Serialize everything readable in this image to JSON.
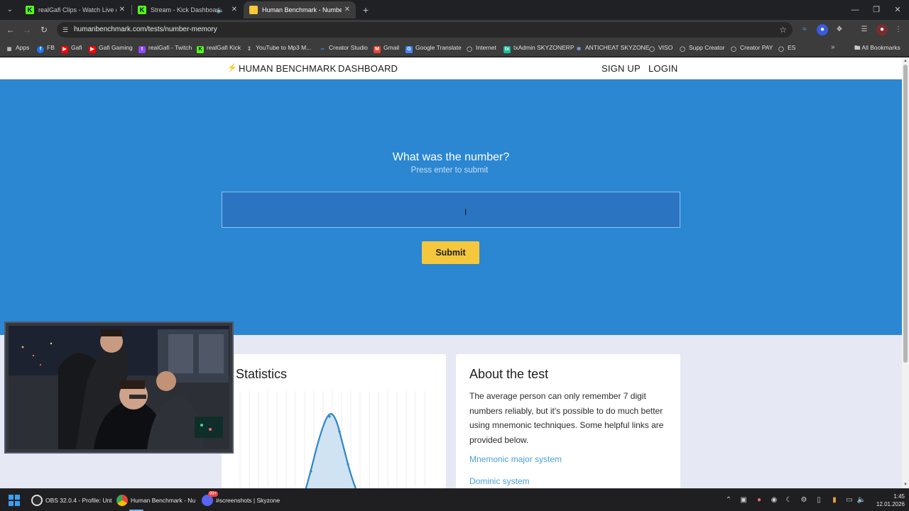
{
  "browser": {
    "tabs": [
      {
        "title": "realGafi Clips - Watch Live on K",
        "favicon": "kick-icon",
        "active": false
      },
      {
        "title": "Stream - Kick Dashboard",
        "favicon": "kick-icon",
        "active": false,
        "audio": true
      },
      {
        "title": "Human Benchmark - Number M",
        "favicon": "human-benchmark-icon",
        "active": true
      }
    ],
    "url": "humanbenchmark.com/tests/number-memory",
    "bookmarks": [
      {
        "label": "Apps",
        "icon": "apps-grid-icon"
      },
      {
        "label": "FB",
        "icon": "facebook-icon"
      },
      {
        "label": "Gafi",
        "icon": "youtube-icon"
      },
      {
        "label": "Gafi Gaming",
        "icon": "youtube-icon"
      },
      {
        "label": "realGafi - Twitch",
        "icon": "twitch-icon"
      },
      {
        "label": "realGafi Kick",
        "icon": "kick-icon"
      },
      {
        "label": "YouTube to Mp3 M...",
        "icon": "download-icon"
      },
      {
        "label": "Creator Studio",
        "icon": "meta-icon"
      },
      {
        "label": "Gmail",
        "icon": "gmail-icon"
      },
      {
        "label": "Google Translate",
        "icon": "translate-icon"
      },
      {
        "label": "Internet",
        "icon": "globe-icon"
      },
      {
        "label": "txAdmin SKYZONERP",
        "icon": "txadmin-icon"
      },
      {
        "label": "ANTICHEAT SKYZONE",
        "icon": "shield-icon"
      },
      {
        "label": "VISO",
        "icon": "globe-icon"
      },
      {
        "label": "Supp Creator",
        "icon": "globe-icon"
      },
      {
        "label": "Creator PAY",
        "icon": "globe-icon"
      },
      {
        "label": "ES",
        "icon": "globe-icon"
      }
    ],
    "all_bookmarks": "All Bookmarks",
    "colors": {
      "accent": "#2b87d1",
      "submit": "#f5c73d",
      "link": "#4a9fd9"
    }
  },
  "site": {
    "brand": "HUMAN BENCHMARK",
    "nav": {
      "dashboard": "DASHBOARD",
      "signup": "SIGN UP",
      "login": "LOGIN"
    }
  },
  "test": {
    "question": "What was the number?",
    "hint": "Press enter to submit",
    "input_value": "",
    "submit": "Submit"
  },
  "statistics": {
    "title": "Statistics"
  },
  "about": {
    "title": "About the test",
    "text": "The average person can only remember 7 digit numbers reliably, but it's possible to do much better using mnemonic techniques. Some helpful links are provided below.",
    "links": [
      "Mnemonic major system",
      "Dominic system"
    ]
  },
  "taskbar": {
    "apps": [
      {
        "label": "OBS 32.0.4 - Profile: Unt",
        "icon": "obs-icon"
      },
      {
        "label": "Human Benchmark - Nu",
        "icon": "chrome-icon"
      },
      {
        "label": "#screenshots | Skyzone",
        "icon": "discord-icon",
        "badge": "99+"
      }
    ],
    "time": "1:45",
    "date": "12.01.2026"
  }
}
